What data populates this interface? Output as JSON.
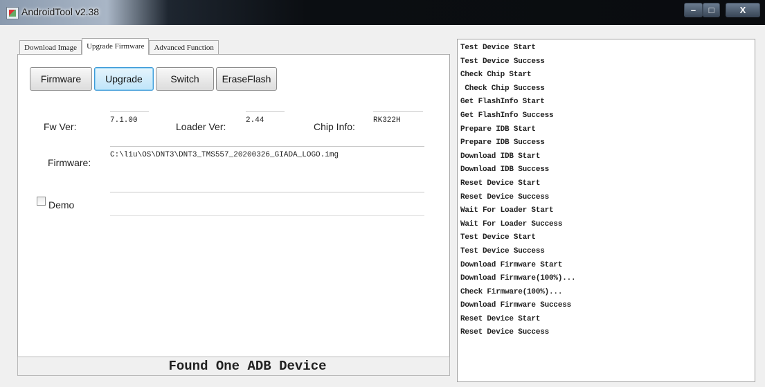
{
  "window": {
    "title": "AndroidTool v2.38",
    "buttons": {
      "min": "–",
      "max": "□",
      "close": "X"
    }
  },
  "tabs": [
    {
      "label": "Download Image"
    },
    {
      "label": "Upgrade Firmware",
      "active": true
    },
    {
      "label": "Advanced Function"
    }
  ],
  "toolbar": {
    "firmware": "Firmware",
    "upgrade": "Upgrade",
    "switch": "Switch",
    "erase": "EraseFlash"
  },
  "info": {
    "fw_ver_label": "Fw Ver:",
    "fw_ver_value": "7.1.00",
    "loader_ver_label": "Loader Ver:",
    "loader_ver_value": "2.44",
    "chip_info_label": "Chip Info:",
    "chip_info_value": "RK322H",
    "firmware_label": "Firmware:",
    "firmware_path": "C:\\liu\\OS\\DNT3\\DNT3_TMS557_20200326_GIADA_LOGO.img",
    "demo_label": "Demo"
  },
  "status": "Found One ADB Device",
  "log": [
    "Test Device Start",
    "Test Device Success",
    "Check Chip Start",
    " Check Chip Success",
    "Get FlashInfo Start",
    "Get FlashInfo Success",
    "Prepare IDB Start",
    "Prepare IDB Success",
    "Download IDB Start",
    "Download IDB Success",
    "Reset Device Start",
    "Reset Device Success",
    "Wait For Loader Start",
    "Wait For Loader Success",
    "Test Device Start",
    "Test Device Success",
    "Download Firmware Start",
    "Download Firmware(100%)...",
    "Check Firmware(100%)...",
    "Download Firmware Success",
    "Reset Device Start",
    "Reset Device Success"
  ]
}
